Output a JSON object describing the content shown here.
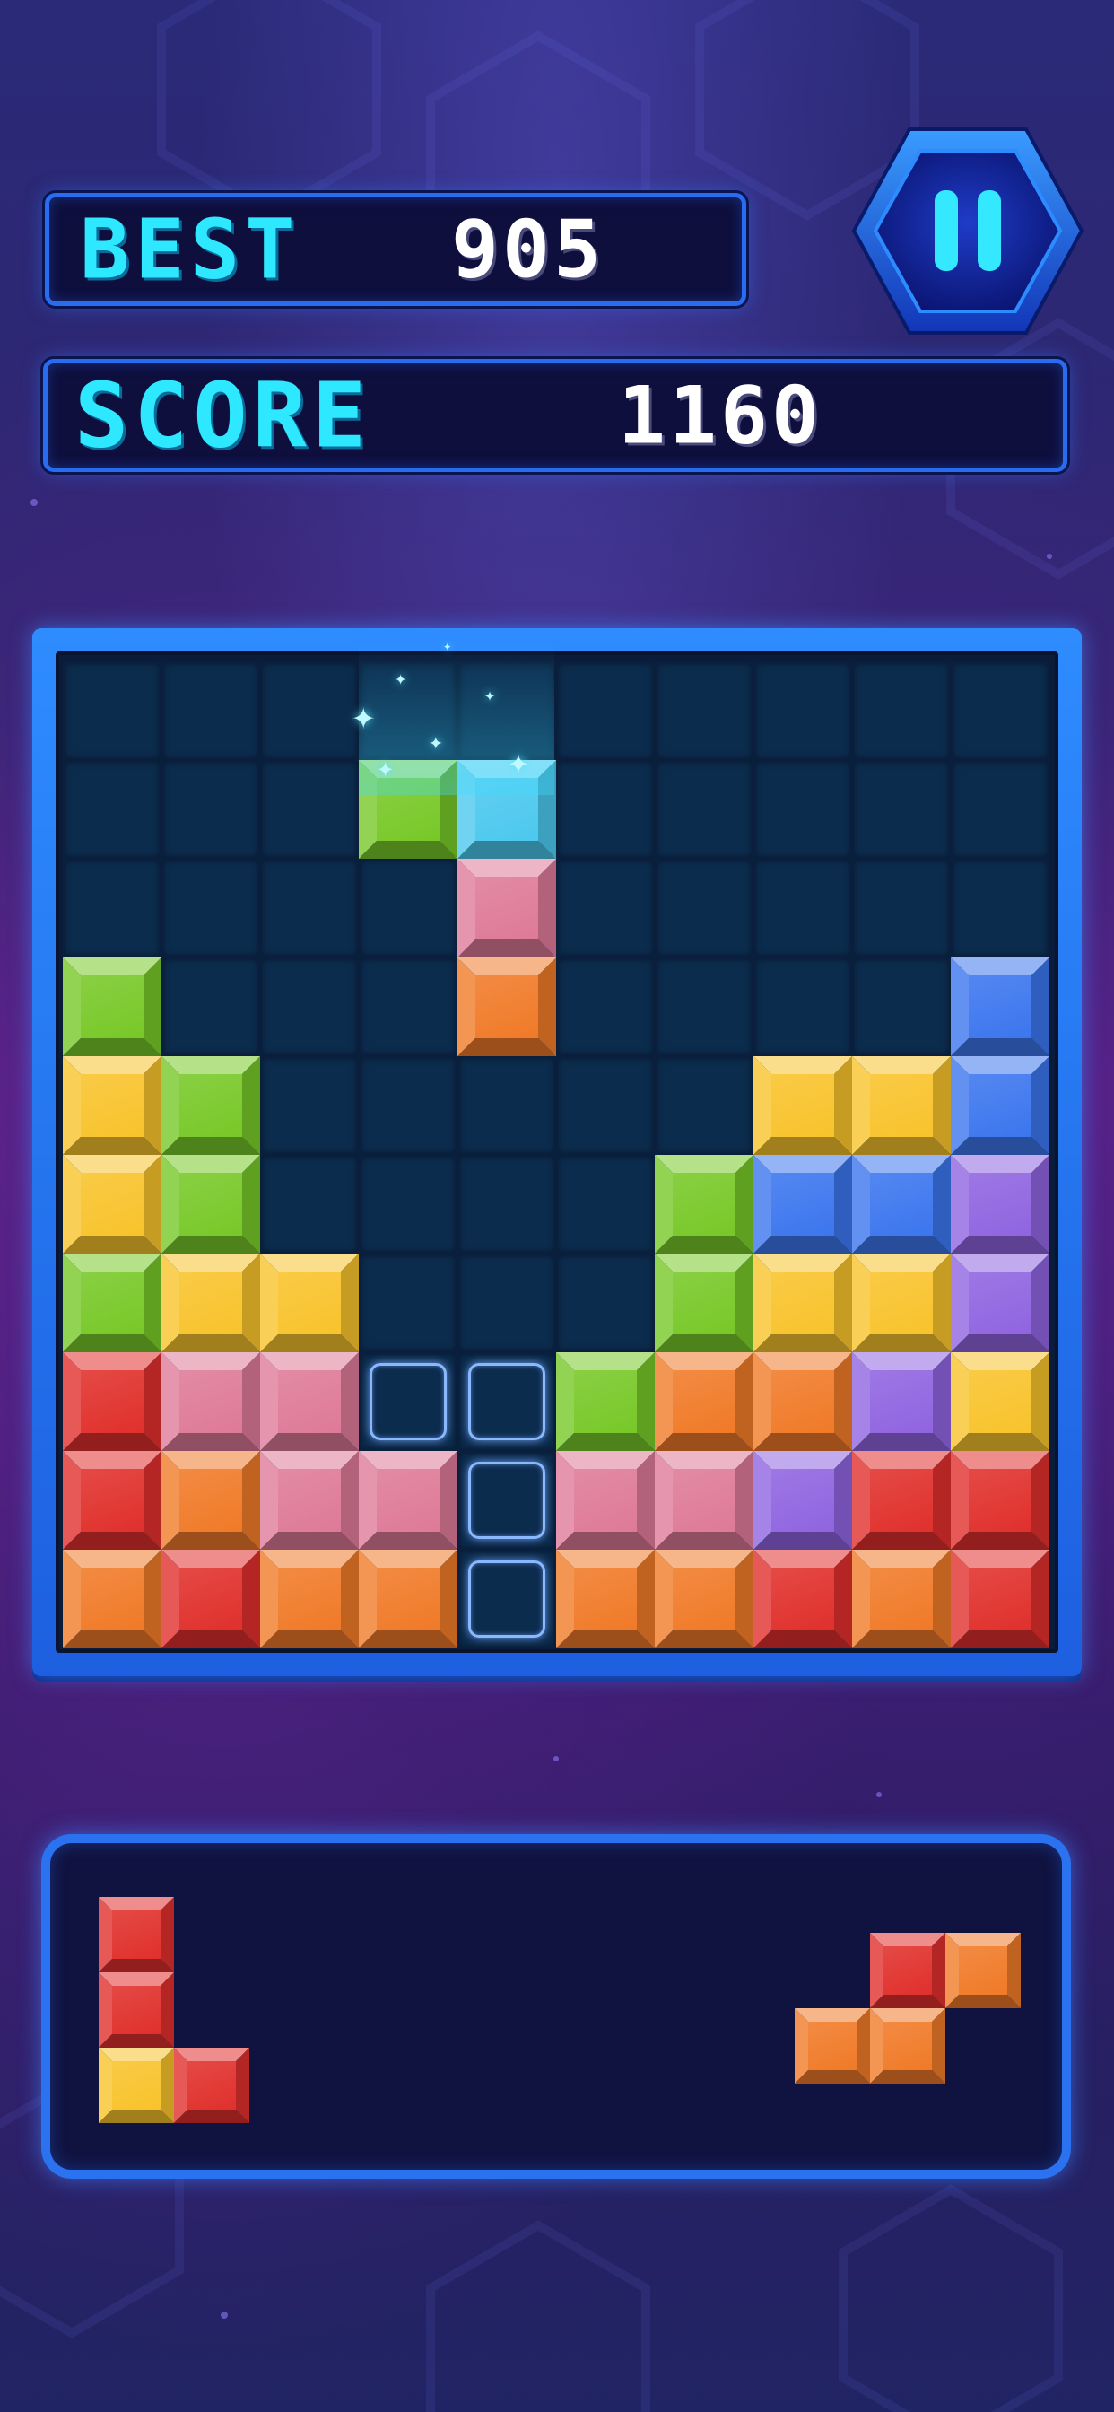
{
  "hud": {
    "best_label": "BEST",
    "best_value": "905",
    "score_label": "SCORE",
    "score_value": "1160",
    "pause_icon": "pause-icon"
  },
  "colors": {
    "red": "#e0302c",
    "orange": "#f07a28",
    "yellow": "#f8c32c",
    "green": "#78c828",
    "pink": "#de7a98",
    "blue": "#3c76ee",
    "purple": "#9064e0",
    "cyan": "#4cc8ee"
  },
  "board": {
    "rows": 10,
    "cols": 10,
    "cells": [
      [
        "",
        "",
        "",
        "",
        "",
        "",
        "",
        "",
        "",
        ""
      ],
      [
        "",
        "",
        "",
        "green*",
        "cyan*",
        "",
        "",
        "",
        "",
        ""
      ],
      [
        "",
        "",
        "",
        "",
        "pink*",
        "",
        "",
        "",
        "",
        ""
      ],
      [
        "green",
        "",
        "",
        "",
        "orange*",
        "",
        "",
        "",
        "",
        "blue"
      ],
      [
        "yellow",
        "green",
        "",
        "",
        "",
        "",
        "",
        "yellow",
        "yellow",
        "blue"
      ],
      [
        "yellow",
        "green",
        "",
        "",
        "",
        "",
        "green",
        "blue",
        "blue",
        "purple"
      ],
      [
        "green",
        "yellow",
        "yellow",
        "",
        "",
        "",
        "green",
        "yellow",
        "yellow",
        "purple"
      ],
      [
        "red",
        "pink",
        "pink",
        "hint",
        "hint",
        "green",
        "orange",
        "orange",
        "purple",
        "yellow"
      ],
      [
        "red",
        "orange",
        "pink",
        "pink",
        "hint",
        "pink",
        "pink",
        "purple",
        "red",
        "red"
      ],
      [
        "orange",
        "red",
        "orange",
        "orange",
        "hint",
        "orange",
        "orange",
        "red",
        "orange",
        "red"
      ]
    ]
  },
  "tray": {
    "pieces": [
      {
        "name": "piece-l",
        "blocks": [
          {
            "r": 0,
            "c": 0,
            "color": "red"
          },
          {
            "r": 1,
            "c": 0,
            "color": "red"
          },
          {
            "r": 2,
            "c": 0,
            "color": "yellow"
          },
          {
            "r": 2,
            "c": 1,
            "color": "red"
          }
        ]
      },
      {
        "name": "piece-s",
        "blocks": [
          {
            "r": 0,
            "c": 1,
            "color": "red"
          },
          {
            "r": 0,
            "c": 2,
            "color": "orange"
          },
          {
            "r": 1,
            "c": 0,
            "color": "orange"
          },
          {
            "r": 1,
            "c": 1,
            "color": "orange"
          }
        ]
      }
    ]
  }
}
